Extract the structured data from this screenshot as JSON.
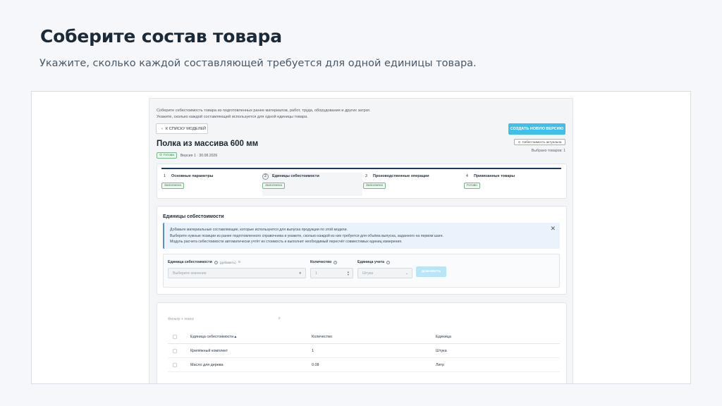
{
  "slide": {
    "title": "Соберите состав товара",
    "subtitle": "Укажите, сколько каждой составляющей требуется для одной единицы товара."
  },
  "app": {
    "intro_line1": "Соберите себестоимость товара из подготовленных ранее материалов, работ, труда, оборудования и других затрат.",
    "intro_line2": "Укажите, сколько каждой составляющей используется для одной единицы товара.",
    "back_button": "К СПИСКУ МОДЕЛЕЙ",
    "create_button": "СОЗДАТЬ НОВУЮ ВЕРСИЮ",
    "cost_actual_badge": "Себестоимость актуальна",
    "selected_count": "Выбрано товаров: 1",
    "model_title": "Полка из массива 600 мм",
    "status_badge": "Готова",
    "version_info": "Версия 1 · 30.08.2026",
    "steps": [
      {
        "num": "1",
        "label": "Основные параметры",
        "tag": "Заполнено"
      },
      {
        "num": "2",
        "label": "Единицы себестоимости",
        "tag": "Заполнено"
      },
      {
        "num": "3",
        "label": "Производственные операции",
        "tag": "Заполнено"
      },
      {
        "num": "4",
        "label": "Привязанные товары",
        "tag": "Готово"
      }
    ],
    "units_title": "Единицы себестоимости",
    "info_lines": [
      "Добавьте материальные составляющие, которые используются для выпуска продукции по этой модели.",
      "Выберите нужные позиции из ранее подготовленного справочника и укажите, сколько каждой из них требуется для объёма выпуска, заданного на первом шаге.",
      "Модуль расчета себестоимости автоматически учтёт их стоимость и выполнит необходимый пересчёт совместимых единиц измерения."
    ],
    "form": {
      "unit_label": "Единица себестоимости",
      "unit_add_hint": "(добавить)",
      "unit_placeholder": "Выберите значение",
      "qty_label": "Количество",
      "qty_value": "1",
      "measure_label": "Единица учета",
      "measure_value": "Штука",
      "add_button": "ДОБАВИТЬ"
    },
    "table": {
      "filter_placeholder": "Фильтр + поиск",
      "headers": [
        "Единица себестоимости",
        "Количество",
        "Единица"
      ],
      "rows": [
        {
          "name": "Крепёжный комплект",
          "qty": "1",
          "unit": "Штука"
        },
        {
          "name": "Масло для дерева",
          "qty": "0.08",
          "unit": "Литр"
        }
      ]
    }
  }
}
